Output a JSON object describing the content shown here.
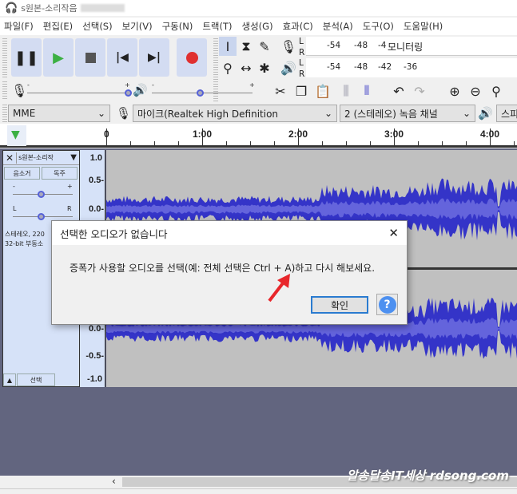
{
  "window": {
    "title": "s원본-소리작음"
  },
  "menu": [
    "파일(F)",
    "편집(E)",
    "선택(S)",
    "보기(V)",
    "구동(N)",
    "트랙(T)",
    "생성(G)",
    "효과(C)",
    "분석(A)",
    "도구(O)",
    "도움말(H)"
  ],
  "meters": {
    "rec_ticks": [
      "-54",
      "-48",
      "-4"
    ],
    "rec_label": "모니터링",
    "play_ticks": [
      "-54",
      "-48",
      "-42",
      "-36"
    ],
    "L": "L",
    "R": "R"
  },
  "sliders": {
    "minus": "-",
    "plus": "+",
    "rec_volume": 1.0,
    "play_volume": 0.5
  },
  "device": {
    "host": "MME",
    "input": "마이크(Realtek High Definition",
    "channels": "2 (스테레오) 녹음 채널",
    "output": "스피"
  },
  "timeline": {
    "labels": [
      "0",
      "1:00",
      "2:00",
      "3:00",
      "4:00"
    ]
  },
  "track": {
    "name": "s원본-소리작",
    "mute": "음소거",
    "solo": "독주",
    "gain_minus": "-",
    "gain_plus": "+",
    "pan_l": "L",
    "pan_r": "R",
    "info1": "스테레오, 220",
    "info2": "32-bit 부동소",
    "select": "선택",
    "scale": [
      "1.0",
      "0.5-",
      "0.0-",
      "0.0-",
      "-0.5-",
      "-1.0"
    ]
  },
  "dialog": {
    "title": "선택한 오디오가 없습니다",
    "message": "증폭가 사용할 오디오를 선택(예:  전체 선택은 Ctrl + A)하고 다시 해보세요.",
    "ok": "확인",
    "help": "?"
  },
  "watermark": "알송달송IT세상 rdsong.com",
  "colors": {
    "wave": "#3434c8",
    "wave_rms": "#6464dc",
    "wave_bg": "#c0c0c0",
    "track_bg": "#62657f",
    "record": "#e03030",
    "play": "#3cb043"
  }
}
